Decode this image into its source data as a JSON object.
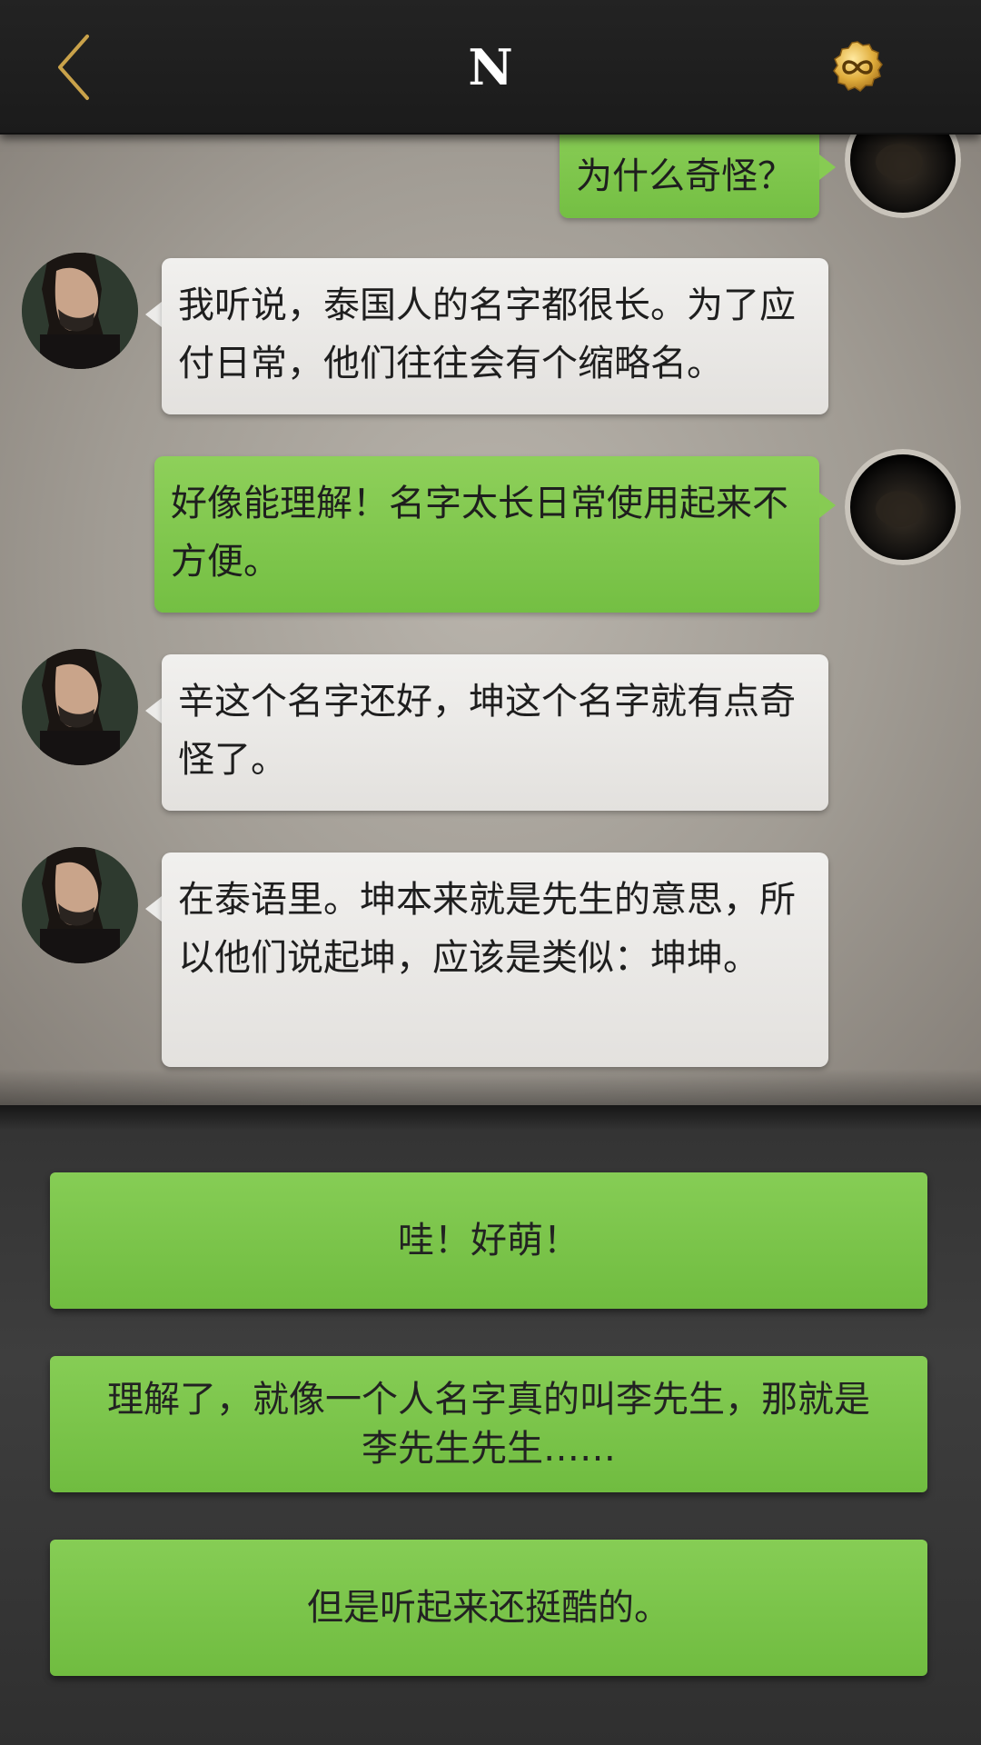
{
  "header": {
    "title": "N",
    "back_icon": "chevron-left-icon",
    "badge_icon": "infinity-coin-icon",
    "accent_color": "#c9a24a"
  },
  "messages": [
    {
      "side": "right",
      "text": "为什么奇怪？"
    },
    {
      "side": "left",
      "text": "我听说，泰国人的名字都很长。为了应付日常，他们往往会有个缩略名。"
    },
    {
      "side": "right",
      "text": "好像能理解！名字太长日常使用起来不方便。"
    },
    {
      "side": "left",
      "text": "辛这个名字还好，坤这个名字就有点奇怪了。"
    },
    {
      "side": "left",
      "text": "在泰语里。坤本来就是先生的意思，所以他们说起坤，应该是类似：坤坤。"
    }
  ],
  "choices": [
    {
      "label": "哇！好萌！"
    },
    {
      "label": "理解了，就像一个人名字真的叫李先生，那就是李先生先生……"
    },
    {
      "label": "但是听起来还挺酷的。"
    }
  ],
  "colors": {
    "bubble_green": "#80c74e",
    "bubble_gray": "#ebe9e6",
    "choice_green": "#7cc44b"
  }
}
